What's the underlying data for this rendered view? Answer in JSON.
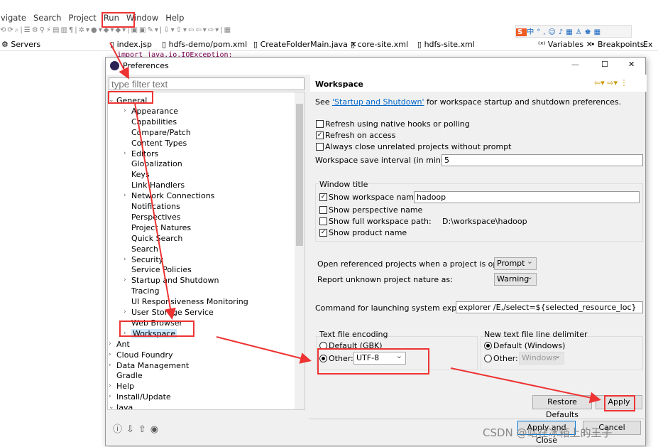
{
  "menu": [
    "vigate",
    "Search",
    "Project",
    "Run",
    "Window",
    "Help"
  ],
  "views": {
    "servers": "Servers",
    "variables": "Variables",
    "breakpoints": "Breakpoints",
    "ex": "Ex"
  },
  "editor_tabs": [
    "index.jsp",
    "hdfs-demo/pom.xml",
    "CreateFolderMain.java",
    "core-site.xml",
    "hdfs-site.xml"
  ],
  "code_line": "import java.io.IOException;",
  "dialog": {
    "title": "Preferences",
    "filter_placeholder": "type filter text",
    "tree": [
      {
        "label": "General",
        "level": 0,
        "expanded": true
      },
      {
        "label": "Appearance",
        "level": 1,
        "chevron": true
      },
      {
        "label": "Capabilities",
        "level": 1
      },
      {
        "label": "Compare/Patch",
        "level": 1
      },
      {
        "label": "Content Types",
        "level": 1
      },
      {
        "label": "Editors",
        "level": 1,
        "chevron": true
      },
      {
        "label": "Globalization",
        "level": 1
      },
      {
        "label": "Keys",
        "level": 1
      },
      {
        "label": "Link Handlers",
        "level": 1
      },
      {
        "label": "Network Connections",
        "level": 1,
        "chevron": true
      },
      {
        "label": "Notifications",
        "level": 1
      },
      {
        "label": "Perspectives",
        "level": 1
      },
      {
        "label": "Project Natures",
        "level": 1
      },
      {
        "label": "Quick Search",
        "level": 1
      },
      {
        "label": "Search",
        "level": 1
      },
      {
        "label": "Security",
        "level": 1,
        "chevron": true
      },
      {
        "label": "Service Policies",
        "level": 1
      },
      {
        "label": "Startup and Shutdown",
        "level": 1,
        "chevron": true
      },
      {
        "label": "Tracing",
        "level": 1
      },
      {
        "label": "UI Responsiveness Monitoring",
        "level": 1
      },
      {
        "label": "User Storage Service",
        "level": 1,
        "chevron": true
      },
      {
        "label": "Web Browser",
        "level": 1
      },
      {
        "label": "Workspace",
        "level": 1,
        "chevron": true,
        "selected": true
      },
      {
        "label": "Ant",
        "level": 0,
        "chevron": true
      },
      {
        "label": "Cloud Foundry",
        "level": 0,
        "chevron": true
      },
      {
        "label": "Data Management",
        "level": 0,
        "chevron": true
      },
      {
        "label": "Gradle",
        "level": 0
      },
      {
        "label": "Help",
        "level": 0,
        "chevron": true
      },
      {
        "label": "Install/Update",
        "level": 0,
        "chevron": true
      },
      {
        "label": "Java",
        "level": 0,
        "expanded": true
      }
    ],
    "page": {
      "title": "Workspace",
      "see_prefix": "See ",
      "see_link": "'Startup and Shutdown'",
      "see_suffix": " for workspace startup and shutdown preferences.",
      "refresh_native": "Refresh using native hooks or polling",
      "refresh_native_checked": false,
      "refresh_access": "Refresh on access",
      "refresh_access_checked": true,
      "always_close": "Always close unrelated projects without prompt",
      "always_close_checked": false,
      "save_interval_label": "Workspace save interval (in minutes):",
      "save_interval": "5",
      "window_title": "Window title",
      "show_name": "Show workspace name:",
      "show_name_checked": true,
      "workspace_name": "hadoop",
      "show_perspective": "Show perspective name",
      "show_perspective_checked": false,
      "show_full_path": "Show full workspace path:",
      "show_full_path_checked": false,
      "full_path": "D:\\workspace\\hadoop",
      "show_product": "Show product name",
      "show_product_checked": true,
      "open_ref_label": "Open referenced projects when a project is opened:",
      "open_ref": "Prompt",
      "unknown_nature_label": "Report unknown project nature as:",
      "unknown_nature": "Warning",
      "explorer_label": "Command for launching system explorer:",
      "explorer_cmd": "explorer /E,/select=${selected_resource_loc}",
      "encoding_title": "Text file encoding",
      "enc_default": "Default (GBK)",
      "enc_other": "Other:",
      "enc_value": "UTF-8",
      "delim_title": "New text file line delimiter",
      "delim_default": "Default (Windows)",
      "delim_other": "Other:",
      "delim_value": "Windows",
      "restore": "Restore Defaults",
      "apply": "Apply"
    },
    "apply_close": "Apply and Close",
    "cancel": "Cancel"
  },
  "watermark": "CSDN @站在冰箱上的王子",
  "colors": {
    "annotation": "#e33333",
    "link": "#0066cc",
    "selection": "#cce8ff"
  }
}
